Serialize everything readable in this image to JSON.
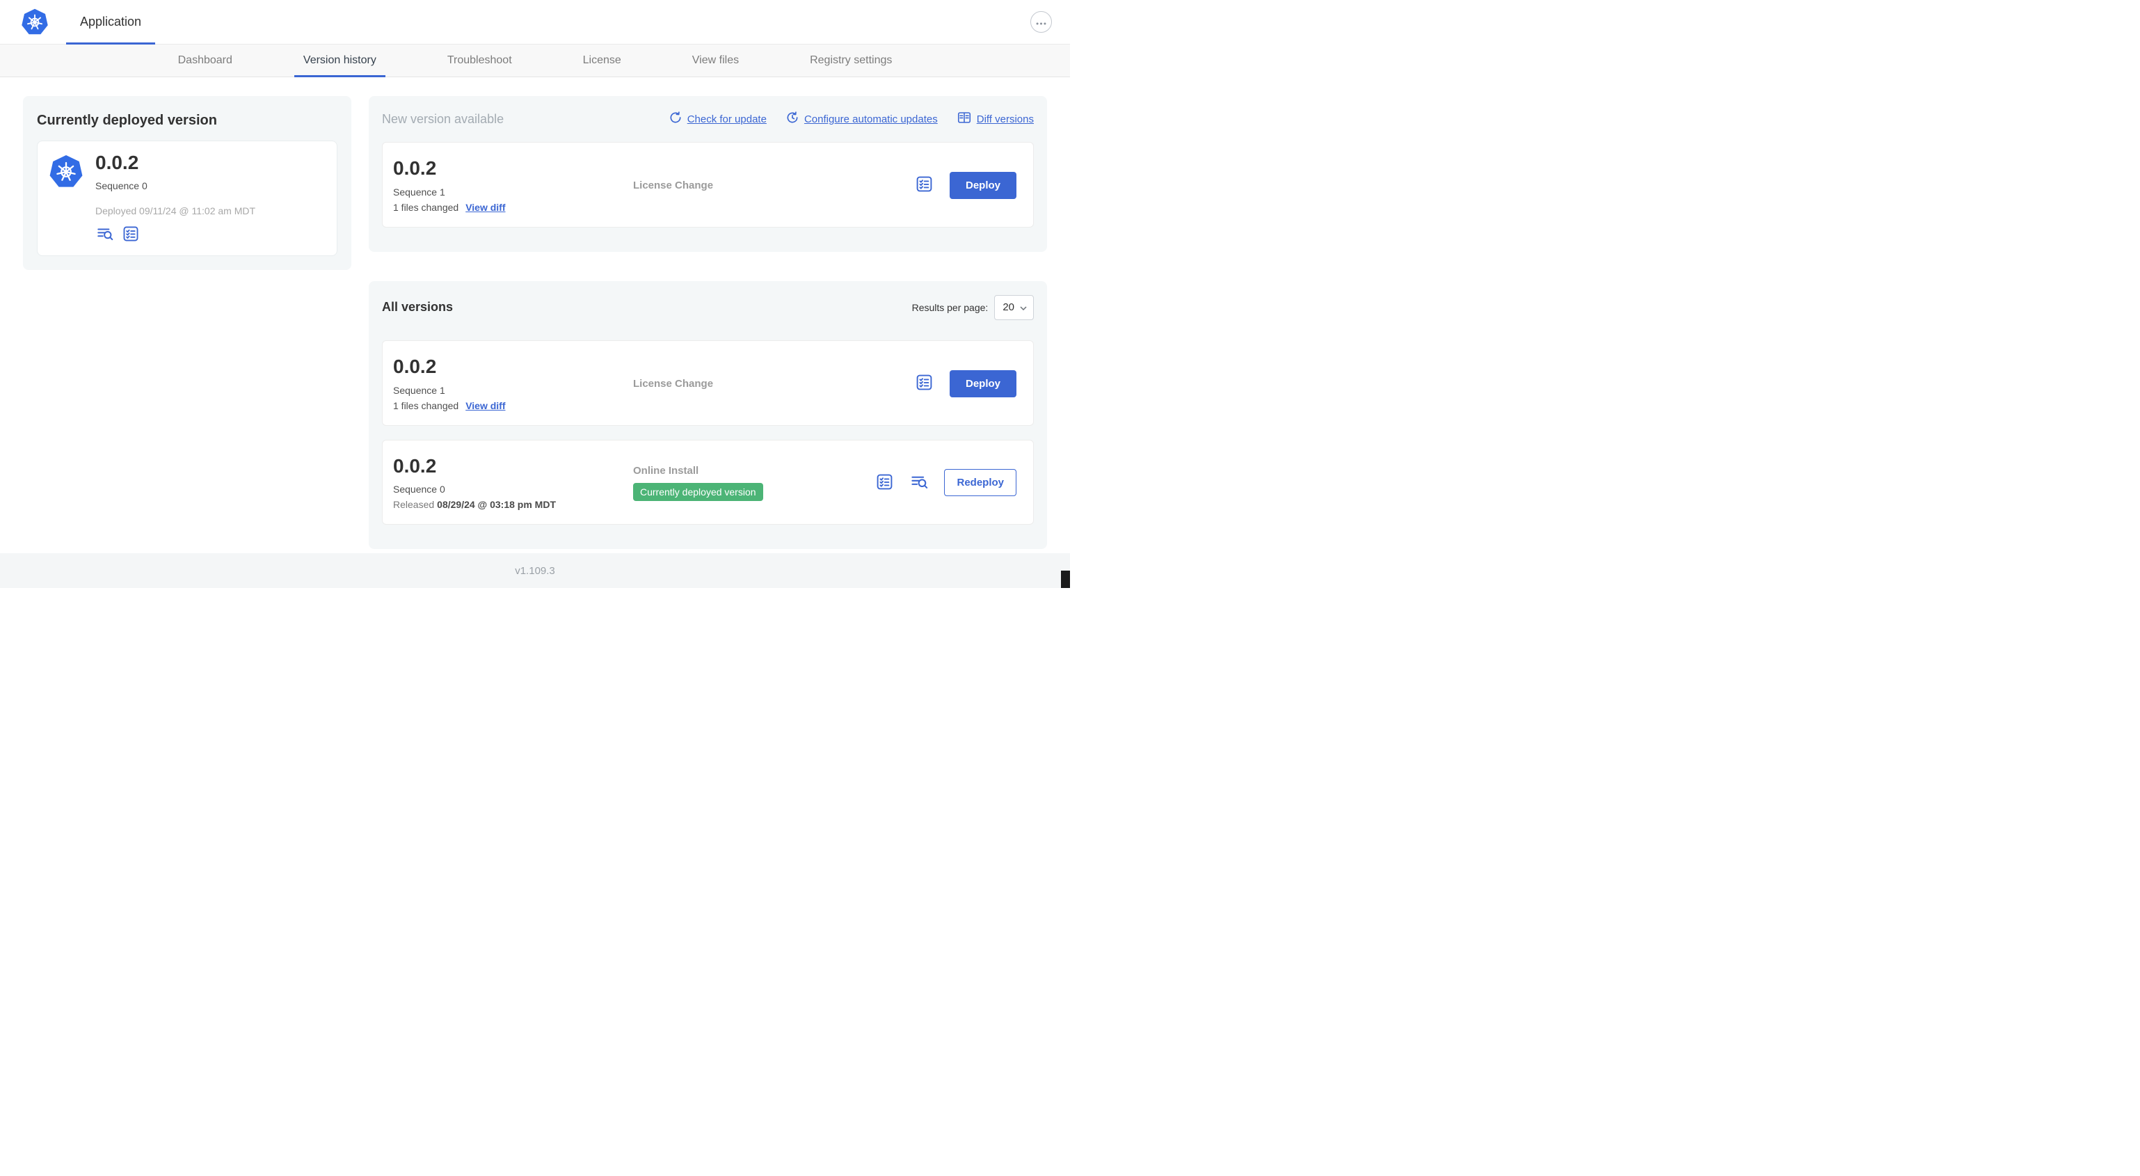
{
  "header": {
    "app_title": "Application"
  },
  "nav": {
    "tabs": [
      {
        "label": "Dashboard",
        "active": false
      },
      {
        "label": "Version history",
        "active": true
      },
      {
        "label": "Troubleshoot",
        "active": false
      },
      {
        "label": "License",
        "active": false
      },
      {
        "label": "View files",
        "active": false
      },
      {
        "label": "Registry settings",
        "active": false
      }
    ]
  },
  "current_version": {
    "title": "Currently deployed version",
    "version": "0.0.2",
    "sequence": "Sequence 0",
    "deployed": "Deployed 09/11/24 @ 11:02 am MDT",
    "icons": [
      "view-logs-icon",
      "preflight-checks-icon"
    ]
  },
  "new_version": {
    "title": "New version available",
    "actions": [
      {
        "label": "Check for update",
        "icon": "refresh-icon"
      },
      {
        "label": "Configure automatic updates",
        "icon": "clock-arrow-icon"
      },
      {
        "label": "Diff versions",
        "icon": "diff-icon"
      }
    ],
    "card": {
      "version": "0.0.2",
      "sequence": "Sequence 1",
      "files_changed": "1 files changed",
      "view_diff": "View diff",
      "source": "License Change",
      "deploy_label": "Deploy"
    }
  },
  "all_versions": {
    "title": "All versions",
    "results_per_page_label": "Results per page:",
    "results_per_page_value": "20",
    "rows": [
      {
        "version": "0.0.2",
        "sequence": "Sequence 1",
        "files_changed": "1 files changed",
        "view_diff": "View diff",
        "source": "License Change",
        "action_label": "Deploy"
      },
      {
        "version": "0.0.2",
        "sequence": "Sequence 0",
        "released_prefix": "Released",
        "released_date": "08/29/24 @ 03:18 pm MDT",
        "source": "Online Install",
        "badge": "Currently deployed version",
        "action_label": "Redeploy"
      }
    ]
  },
  "footer": {
    "version": "v1.109.3"
  },
  "colors": {
    "accent_blue": "#3b66d3",
    "kubernetes_blue": "#326ce5",
    "badge_green": "#4cb476",
    "panel_gray": "#f4f7f8"
  }
}
